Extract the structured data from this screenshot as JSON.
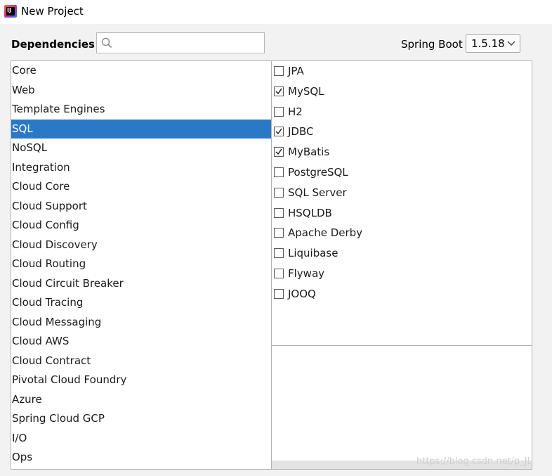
{
  "window": {
    "title": "New Project"
  },
  "dependencies_label": "Dependencies",
  "search": {
    "value": "",
    "placeholder": ""
  },
  "spring_boot": {
    "label": "Spring Boot",
    "version": "1.5.18"
  },
  "categories": [
    "Core",
    "Web",
    "Template Engines",
    "SQL",
    "NoSQL",
    "Integration",
    "Cloud Core",
    "Cloud Support",
    "Cloud Config",
    "Cloud Discovery",
    "Cloud Routing",
    "Cloud Circuit Breaker",
    "Cloud Tracing",
    "Cloud Messaging",
    "Cloud AWS",
    "Cloud Contract",
    "Pivotal Cloud Foundry",
    "Azure",
    "Spring Cloud GCP",
    "I/O",
    "Ops"
  ],
  "selected_category": "SQL",
  "dependencies": [
    {
      "name": "JPA",
      "checked": false
    },
    {
      "name": "MySQL",
      "checked": true
    },
    {
      "name": "H2",
      "checked": false
    },
    {
      "name": "JDBC",
      "checked": true
    },
    {
      "name": "MyBatis",
      "checked": true
    },
    {
      "name": "PostgreSQL",
      "checked": false
    },
    {
      "name": "SQL Server",
      "checked": false
    },
    {
      "name": "HSQLDB",
      "checked": false
    },
    {
      "name": "Apache Derby",
      "checked": false
    },
    {
      "name": "Liquibase",
      "checked": false
    },
    {
      "name": "Flyway",
      "checked": false
    },
    {
      "name": "JOOQ",
      "checked": false
    }
  ],
  "watermark": "https://blog.csdn.net/p_JL",
  "colors": {
    "selection": "#2a79c7",
    "window_bg": "#f2f2f2",
    "panel_bg": "#ffffff"
  },
  "icons": {
    "app": "intellij-idea-icon",
    "search": "search-icon",
    "dropdown": "chevron-down-icon",
    "check": "checkmark-icon"
  }
}
